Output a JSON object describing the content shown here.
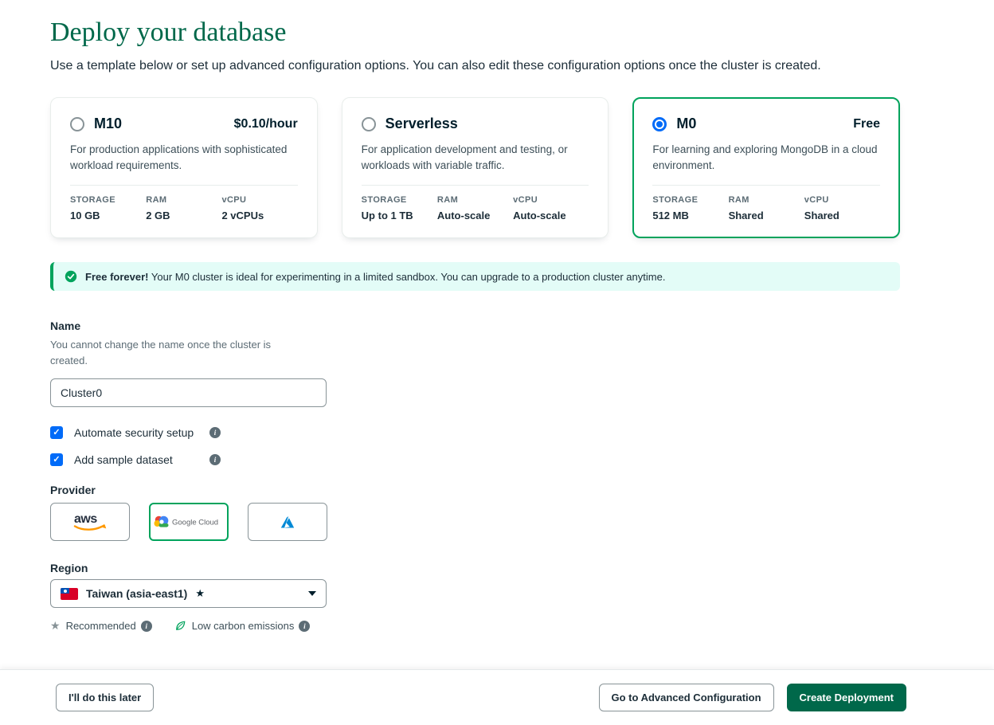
{
  "page": {
    "title": "Deploy your database",
    "subtitle": "Use a template below or set up advanced configuration options. You can also edit these configuration options once the cluster is created."
  },
  "tiers": [
    {
      "name": "M10",
      "price": "$0.10/hour",
      "description": "For production applications with sophisticated workload requirements.",
      "selected": false,
      "specs": [
        {
          "label": "STORAGE",
          "value": "10 GB"
        },
        {
          "label": "RAM",
          "value": "2 GB"
        },
        {
          "label": "vCPU",
          "value": "2 vCPUs"
        }
      ]
    },
    {
      "name": "Serverless",
      "price": "",
      "description": "For application development and testing, or workloads with variable traffic.",
      "selected": false,
      "specs": [
        {
          "label": "STORAGE",
          "value": "Up to 1 TB"
        },
        {
          "label": "RAM",
          "value": "Auto-scale"
        },
        {
          "label": "vCPU",
          "value": "Auto-scale"
        }
      ]
    },
    {
      "name": "M0",
      "price": "Free",
      "description": "For learning and exploring MongoDB in a cloud environment.",
      "selected": true,
      "specs": [
        {
          "label": "STORAGE",
          "value": "512 MB"
        },
        {
          "label": "RAM",
          "value": "Shared"
        },
        {
          "label": "vCPU",
          "value": "Shared"
        }
      ]
    }
  ],
  "banner": {
    "bold_text": "Free forever!",
    "text": "Your M0 cluster is ideal for experimenting in a limited sandbox. You can upgrade to a production cluster anytime."
  },
  "name_section": {
    "label": "Name",
    "helper": "You cannot change the name once the cluster is created.",
    "value": "Cluster0"
  },
  "checkboxes": [
    {
      "label": "Automate security setup",
      "checked": true
    },
    {
      "label": "Add sample dataset",
      "checked": true
    }
  ],
  "provider": {
    "label": "Provider",
    "selected": "google-cloud",
    "options": [
      {
        "id": "aws",
        "label": "aws"
      },
      {
        "id": "google-cloud",
        "label": "Google Cloud"
      },
      {
        "id": "azure",
        "label": ""
      }
    ]
  },
  "region": {
    "label": "Region",
    "selected": "Taiwan (asia-east1)",
    "legend": [
      {
        "label": "Recommended"
      },
      {
        "label": "Low carbon emissions"
      }
    ]
  },
  "footer": {
    "later_label": "I'll do this later",
    "advanced_label": "Go to Advanced Configuration",
    "create_label": "Create Deployment"
  },
  "icons": {
    "star": "★",
    "check": "✓",
    "info": "i"
  },
  "colors": {
    "heading_green": "#00684A",
    "selected_border_green": "#00A35C",
    "radio_checkbox_blue": "#016BF8",
    "banner_bg": "#E3FCF7",
    "primary_button_green": "#00684A",
    "aws_orange": "#FF9900",
    "azure_blue": "#0089D6"
  }
}
